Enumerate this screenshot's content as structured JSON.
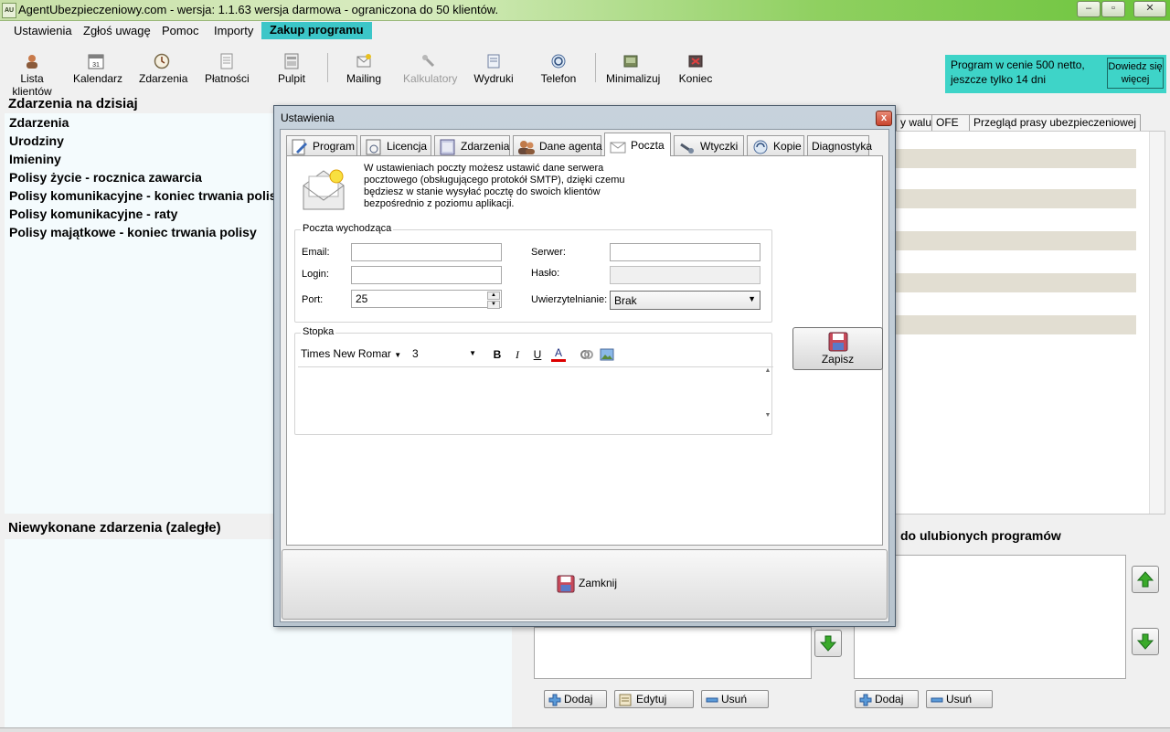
{
  "window": {
    "title": "AgentUbezpieczeniowy.com - wersja: 1.1.63 wersja darmowa - ograniczona do 50 klientów.",
    "icon_text": "AU"
  },
  "menu": [
    "Ustawienia",
    "Zgłoś uwagę",
    "Pomoc",
    "Importy",
    "Zakup programu"
  ],
  "toolbar": [
    {
      "label": "Lista klientów",
      "icon": "users-icon"
    },
    {
      "label": "Kalendarz",
      "icon": "calendar-icon",
      "badge": "31"
    },
    {
      "label": "Zdarzenia",
      "icon": "clock-icon"
    },
    {
      "label": "Płatności",
      "icon": "document-icon"
    },
    {
      "label": "Pulpit",
      "icon": "desktop-icon"
    },
    {
      "label": "Mailing",
      "icon": "mail-icon"
    },
    {
      "label": "Kalkulatory",
      "icon": "calculator-icon"
    },
    {
      "label": "Wydruki",
      "icon": "printer-icon"
    },
    {
      "label": "Telefon",
      "icon": "phone-icon"
    },
    {
      "label": "Minimalizuj",
      "icon": "minimize-icon"
    },
    {
      "label": "Koniec",
      "icon": "exit-icon"
    }
  ],
  "promo": {
    "text": "Program w cenie 500 netto, jeszcze tylko 14 dni",
    "button": "Dowiedz się więcej"
  },
  "left_panel": {
    "today_title": "Zdarzenia na dzisiaj",
    "events": [
      "Zdarzenia",
      "Urodziny",
      "Imieniny",
      "Polisy życie - rocznica zawarcia",
      "Polisy komunikacyjne - koniec trwania polisy",
      "Polisy komunikacyjne - raty",
      "Polisy majątkowe - koniec trwania polisy"
    ],
    "overdue_title": "Niewykonane zdarzenia (zaległe)"
  },
  "right_panel": {
    "tabs": [
      "y walut",
      "OFE",
      "Przegląd prasy ubezpieczeniowej"
    ],
    "fav_title": "do ulubionych programów",
    "buttons": {
      "add": "Dodaj",
      "edit": "Edytuj",
      "remove": "Usuń"
    }
  },
  "dialog": {
    "title": "Ustawienia",
    "close_symbol": "x",
    "tabs": [
      "Program",
      "Licencja",
      "Zdarzenia",
      "Dane agenta",
      "Poczta",
      "Wtyczki",
      "Kopie",
      "Diagnostyka"
    ],
    "active_tab": "Poczta",
    "info_text": "W ustawieniach poczty możesz ustawić dane serwera pocztowego (obsługującego protokół SMTP), dzięki czemu będziesz w stanie wysyłać pocztę do swoich klientów bezpośrednio z poziomu aplikacji.",
    "outgoing": {
      "group_label": "Poczta wychodząca",
      "email_label": "Email:",
      "email_value": "",
      "login_label": "Login:",
      "login_value": "",
      "port_label": "Port:",
      "port_value": "25",
      "server_label": "Serwer:",
      "server_value": "",
      "password_label": "Hasło:",
      "auth_label": "Uwierzytelnianie:",
      "auth_value": "Brak"
    },
    "save_button": "Zapisz",
    "footer": {
      "group_label": "Stopka",
      "font": "Times New Romar",
      "size": "3",
      "bold": "B",
      "italic": "I",
      "underline": "U",
      "color": "A"
    },
    "close_button": "Zamknij"
  }
}
